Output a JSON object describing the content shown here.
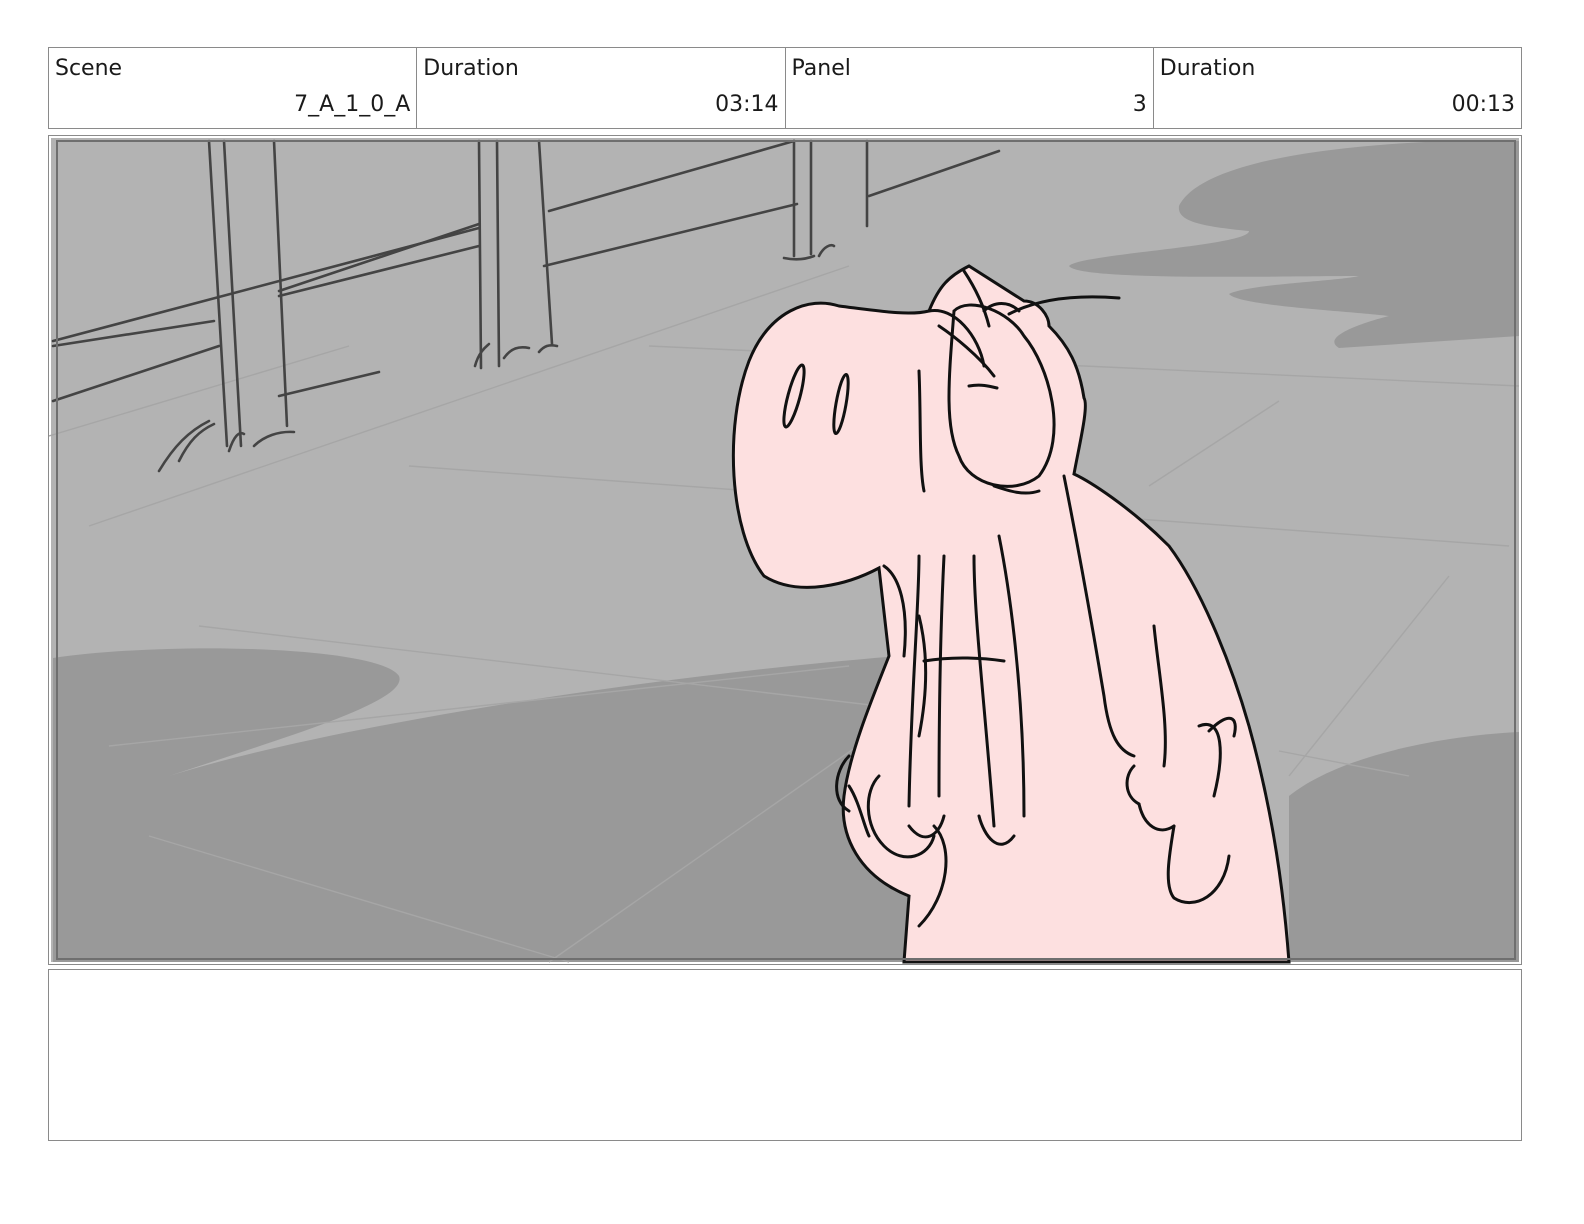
{
  "header": {
    "scene_label": "Scene",
    "scene_value": "7_A_1_0_A",
    "duration_label": "Duration",
    "duration_value": "03:14",
    "panel_label": "Panel",
    "panel_value": "3",
    "panel_duration_label": "Duration",
    "panel_duration_value": "00:13"
  },
  "artwork": {
    "character_color": "#fde0e0",
    "background_color": "#b3b3b3",
    "shadow_color": "#999999",
    "line_color": "#111111"
  },
  "notes": {
    "text": ""
  }
}
